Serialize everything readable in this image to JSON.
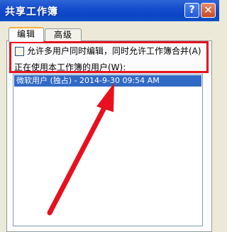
{
  "window": {
    "title": "共享工作簿",
    "help_label": "?",
    "close_label": "✕"
  },
  "tabs": [
    {
      "label": "编辑",
      "selected": true
    },
    {
      "label": "高级",
      "selected": false
    }
  ],
  "edit": {
    "allow_multiuser_label": "允许多用户同时编辑，同时允许工作簿合并(A)",
    "allow_multiuser_checked": false,
    "current_users_label": "正在使用本工作簿的用户(W):",
    "users": [
      {
        "text": "微软用户 (独占) - 2014-9-30 09:54 AM",
        "selected": true
      }
    ]
  },
  "annotation": {
    "highlight_color": "#e8101e",
    "arrow_color": "#e8101e"
  }
}
